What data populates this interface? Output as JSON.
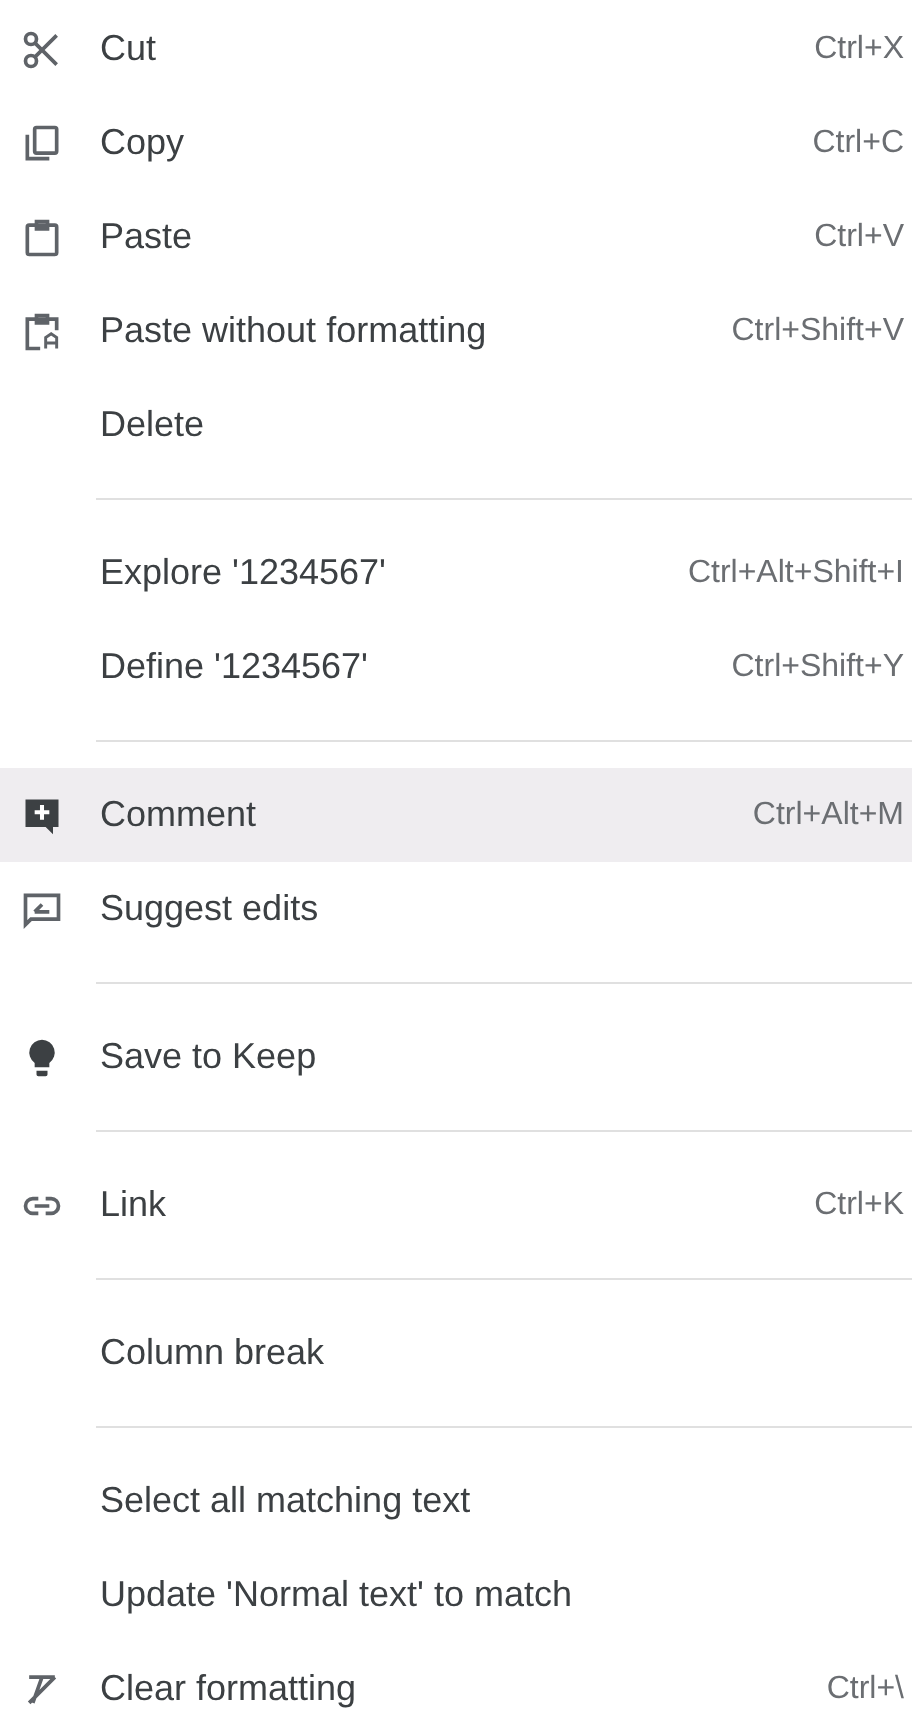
{
  "menu": {
    "sections": [
      {
        "items": [
          {
            "label": "Cut",
            "shortcut": "Ctrl+X",
            "selected": false
          },
          {
            "label": "Copy",
            "shortcut": "Ctrl+C",
            "selected": false
          },
          {
            "label": "Paste",
            "shortcut": "Ctrl+V",
            "selected": false
          },
          {
            "label": "Paste without formatting",
            "shortcut": "Ctrl+Shift+V",
            "selected": false
          },
          {
            "label": "Delete",
            "selected": false
          }
        ]
      },
      {
        "items": [
          {
            "label": "Explore '1234567'",
            "shortcut": "Ctrl+Alt+Shift+I",
            "selected": false
          },
          {
            "label": "Define '1234567'",
            "shortcut": "Ctrl+Shift+Y",
            "selected": false
          }
        ]
      },
      {
        "items": [
          {
            "label": "Comment",
            "shortcut": "Ctrl+Alt+M",
            "selected": true
          },
          {
            "label": "Suggest edits",
            "selected": false
          }
        ]
      },
      {
        "items": [
          {
            "label": "Save to Keep",
            "selected": false
          }
        ]
      },
      {
        "items": [
          {
            "label": "Link",
            "shortcut": "Ctrl+K",
            "selected": false
          }
        ]
      },
      {
        "items": [
          {
            "label": "Column break",
            "selected": false
          }
        ]
      },
      {
        "items": [
          {
            "label": "Select all matching text",
            "selected": false
          },
          {
            "label": "Update 'Normal text' to match",
            "selected": false
          },
          {
            "label": "Clear formatting",
            "shortcut": "Ctrl+\\",
            "selected": false
          }
        ]
      }
    ]
  }
}
